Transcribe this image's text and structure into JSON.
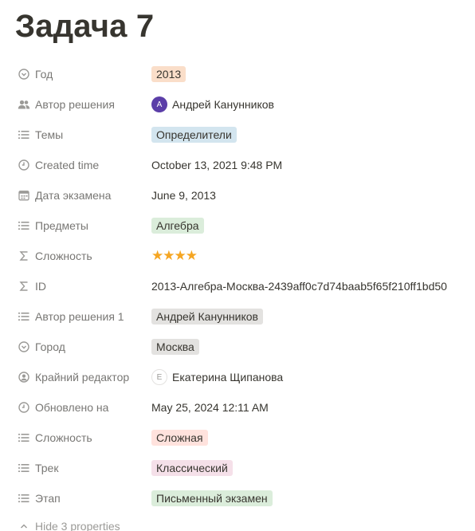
{
  "page": {
    "title": "Задача 7"
  },
  "colors": {
    "tag_year": "#fadec9",
    "tag_topic": "#d3e5ef",
    "tag_subject": "#dbeddb",
    "tag_gray": "#e3e2e0",
    "tag_hard": "#ffe2dd",
    "tag_track": "#f5e0e9",
    "tag_stage": "#dbeddb",
    "avatar": "#5b3ea8",
    "stars": "#f5a623"
  },
  "properties": [
    {
      "name": "Год",
      "icon": "select-icon",
      "value": "2013"
    },
    {
      "name": "Автор решения",
      "icon": "people-icon",
      "value": "Андрей Канунников",
      "avatar": "А"
    },
    {
      "name": "Темы",
      "icon": "list-icon",
      "value": "Определители"
    },
    {
      "name": "Created time",
      "icon": "clock-icon",
      "value": "October 13, 2021 9:48 PM"
    },
    {
      "name": "Дата экзамена",
      "icon": "calendar-icon",
      "value": "June 9, 2013"
    },
    {
      "name": "Предметы",
      "icon": "list-icon",
      "value": "Алгебра"
    },
    {
      "name": "Сложность",
      "icon": "sigma-icon",
      "value": "★★★★",
      "rating": 4
    },
    {
      "name": "ID",
      "icon": "sigma-icon",
      "value": "2013-Алгебра-Москва-2439aff0c7d74baab5f65f210ff1bd50"
    },
    {
      "name": "Автор решения 1",
      "icon": "list-icon",
      "value": "Андрей Канунников"
    },
    {
      "name": "Город",
      "icon": "select-icon",
      "value": "Москва"
    },
    {
      "name": "Крайний редактор",
      "icon": "person-circle-icon",
      "value": "Екатерина Щипанова",
      "avatar": "Е"
    },
    {
      "name": "Обновлено на",
      "icon": "clock-icon",
      "value": "May 25, 2024 12:11 AM"
    },
    {
      "name": "Сложность",
      "icon": "list-icon",
      "value": "Сложная"
    },
    {
      "name": "Трек",
      "icon": "list-icon",
      "value": "Классический"
    },
    {
      "name": "Этап",
      "icon": "list-icon",
      "value": "Письменный экзамен"
    }
  ],
  "footer": {
    "hide_label": "Hide 3 properties",
    "icon": "chevron-up-icon"
  }
}
